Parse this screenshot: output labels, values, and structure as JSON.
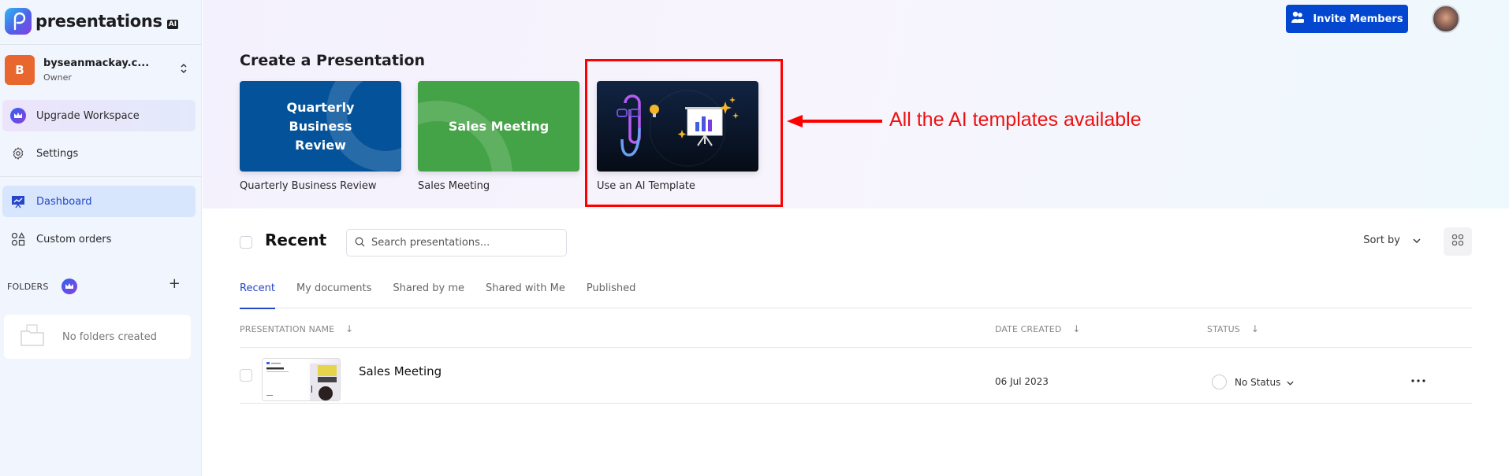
{
  "app": {
    "brand_name": "presentations",
    "brand_suffix": "AI"
  },
  "workspace": {
    "initial": "B",
    "name": "byseanmackay.c...",
    "role": "Owner"
  },
  "sidebar": {
    "items": [
      {
        "label": "Upgrade Workspace",
        "icon": "crown-icon"
      },
      {
        "label": "Settings",
        "icon": "gear-icon"
      },
      {
        "label": "Dashboard",
        "icon": "presentation-chart-icon",
        "active": true
      },
      {
        "label": "Custom orders",
        "icon": "shapes-icon"
      }
    ],
    "folders": {
      "heading": "FOLDERS",
      "empty_text": "No folders created"
    }
  },
  "header": {
    "invite_label": "Invite Members"
  },
  "create": {
    "title": "Create a Presentation",
    "templates": [
      {
        "card_text": "Quarterly Business Review",
        "label": "Quarterly Business Review",
        "color": "#03529a"
      },
      {
        "card_text": "Sales Meeting",
        "label": "Sales Meeting",
        "color": "#44a346"
      },
      {
        "card_text": "",
        "label": "Use an AI Template",
        "color": "#0b1a30"
      }
    ]
  },
  "annotation": {
    "text": "All the AI templates available",
    "color": "#ff0000"
  },
  "recent": {
    "title": "Recent",
    "search_placeholder": "Search presentations...",
    "sort_label": "Sort by",
    "tabs": [
      {
        "label": "Recent",
        "active": true
      },
      {
        "label": "My documents"
      },
      {
        "label": "Shared by me"
      },
      {
        "label": "Shared with Me"
      },
      {
        "label": "Published"
      }
    ],
    "columns": [
      "PRESENTATION NAME",
      "DATE CREATED",
      "STATUS"
    ],
    "rows": [
      {
        "name": "Sales Meeting",
        "date": "06 Jul 2023",
        "status": "No Status"
      }
    ]
  },
  "colors": {
    "primary": "#0347d0",
    "active_tab": "#2446c7",
    "workspace_avatar": "#e8672f"
  }
}
